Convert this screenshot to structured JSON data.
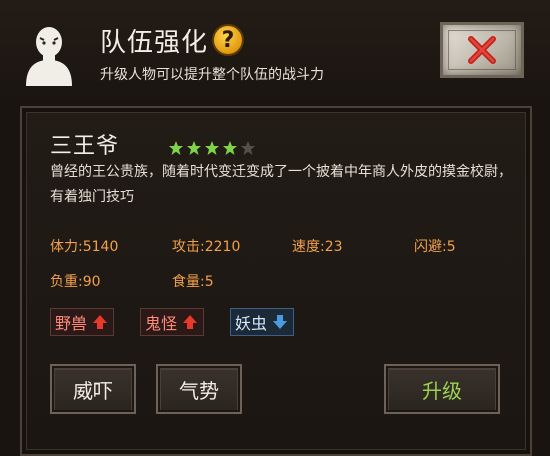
{
  "header": {
    "title": "队伍强化",
    "subtitle": "升级人物可以提升整个队伍的战斗力",
    "help_icon": "?",
    "close_icon": "close-icon"
  },
  "character": {
    "name": "三王爷",
    "stars_filled": 4,
    "stars_total": 5,
    "description": "曾经的王公贵族，随着时代变迁变成了一个披着中年商人外皮的摸金校尉，有着独门技巧",
    "stats": [
      {
        "label": "体力:",
        "value": "5140"
      },
      {
        "label": "攻击:",
        "value": "2210"
      },
      {
        "label": "速度:",
        "value": "23"
      },
      {
        "label": "闪避:",
        "value": "5"
      },
      {
        "label": "负重:",
        "value": "90"
      },
      {
        "label": "食量:",
        "value": "5"
      }
    ],
    "traits": [
      {
        "label": "野兽",
        "direction": "up"
      },
      {
        "label": "鬼怪",
        "direction": "up"
      },
      {
        "label": "妖虫",
        "direction": "down"
      }
    ]
  },
  "buttons": {
    "intimidate": "威吓",
    "momentum": "气势",
    "upgrade": "升级"
  },
  "colors": {
    "stat_text": "#f2a14a",
    "trait_up_text": "#ff8a7a",
    "trait_up_arrow": "#e83a2a",
    "trait_down_arrow": "#4a9be0",
    "upgrade_text": "#9bd34f",
    "star_on": "#7fd24a",
    "star_off": "#555049",
    "help_icon_fill": "#f0b323"
  }
}
